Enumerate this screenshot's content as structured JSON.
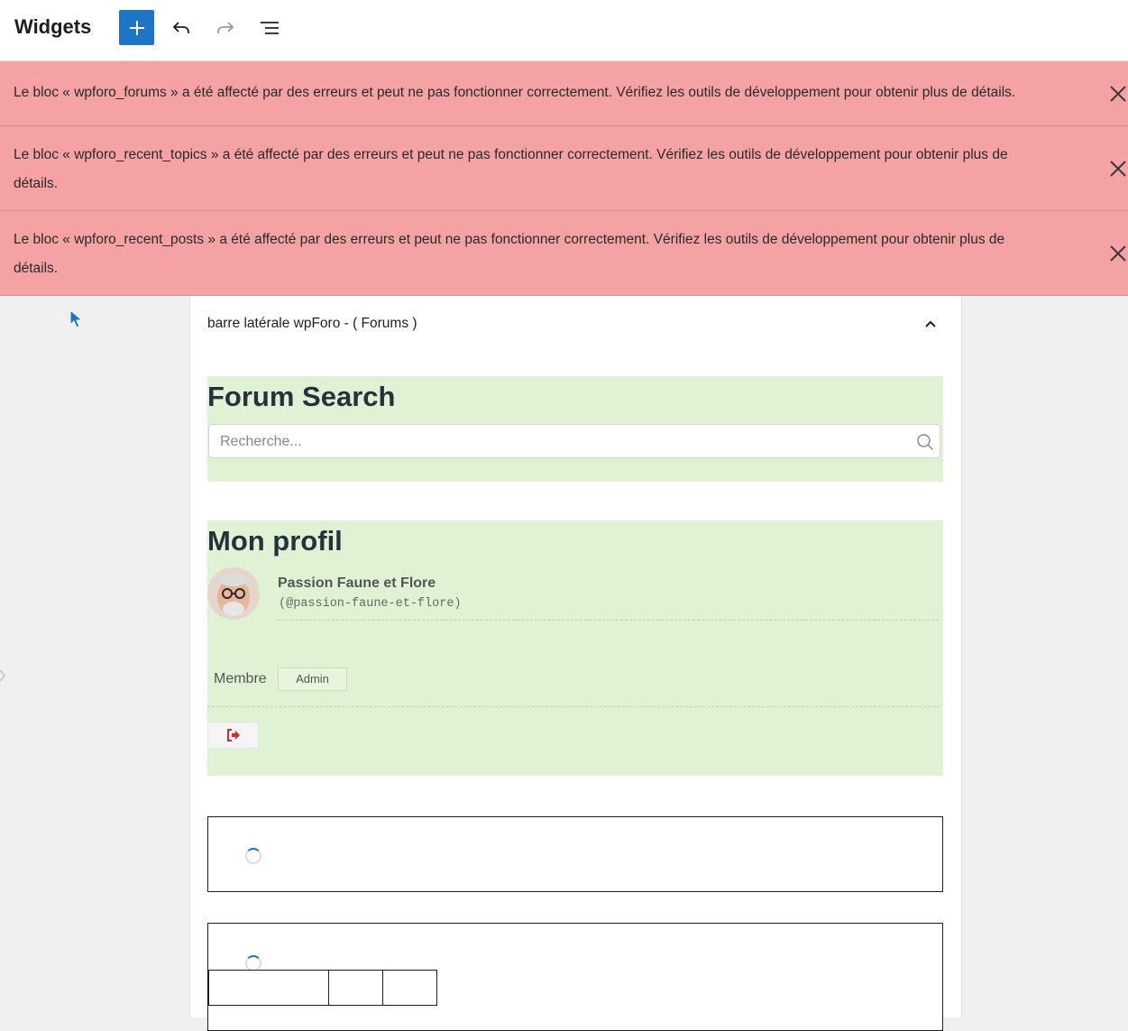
{
  "header": {
    "title": "Widgets",
    "add_icon": "plus-icon",
    "undo_icon": "undo-icon",
    "redo_icon": "redo-icon",
    "list_view_icon": "list-view-icon",
    "accent_color": "#1d75c6"
  },
  "notices": [
    {
      "text": "Le bloc « wpforo_forums » a été affecté par des erreurs et peut ne pas fonctionner correctement. Vérifiez les outils de développement pour obtenir plus de détails.",
      "icon": "close-icon"
    },
    {
      "text": "Le bloc « wpforo_recent_topics » a été affecté par des erreurs et peut ne pas fonctionner correctement. Vérifiez les outils de développement pour obtenir plus de détails.",
      "icon": "close-icon"
    },
    {
      "text": "Le bloc « wpforo_recent_posts » a été affecté par des erreurs et peut ne pas fonctionner correctement. Vérifiez les outils de développement pour obtenir plus de détails.",
      "icon": "close-icon"
    }
  ],
  "notice_color": "#f4a2a3",
  "widget_area": {
    "title": "barre latérale wpForo - ( Forums )",
    "toggle_icon": "chevron-up-icon"
  },
  "search_block": {
    "heading": "Forum Search",
    "placeholder": "Recherche...",
    "icon": "search-icon"
  },
  "profile_block": {
    "heading": "Mon profil",
    "name": "Passion Faune et Flore",
    "handle": "(@passion-faune-et-flore)",
    "role_label": "Membre",
    "role_badge": "Admin",
    "logout_icon": "sign-out-icon"
  },
  "block_bg_color": "#dff3d4"
}
